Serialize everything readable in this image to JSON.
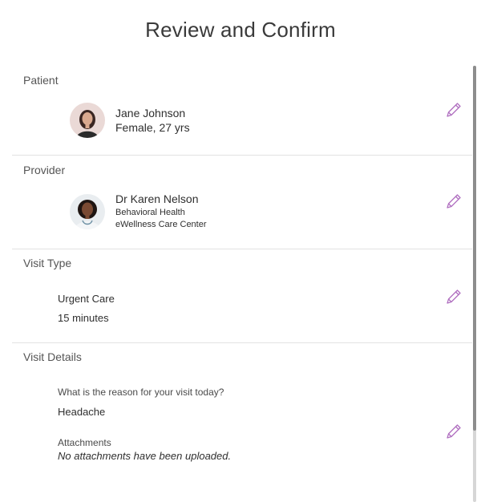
{
  "page": {
    "title": "Review and Confirm"
  },
  "patient": {
    "label": "Patient",
    "name": "Jane Johnson",
    "details": "Female, 27 yrs"
  },
  "provider": {
    "label": "Provider",
    "name": "Dr Karen Nelson",
    "specialty": "Behavioral Health",
    "organization": "eWellness Care Center"
  },
  "visit_type": {
    "label": "Visit Type",
    "type": "Urgent Care",
    "duration": "15 minutes"
  },
  "visit_details": {
    "label": "Visit Details",
    "question": "What is the reason for your visit today?",
    "answer": "Headache",
    "attachments_label": "Attachments",
    "attachments_value": "No attachments have been uploaded."
  },
  "colors": {
    "accent": "#b06fc0",
    "divider": "#e2e2e2"
  },
  "icons": {
    "edit": "pencil-icon"
  }
}
